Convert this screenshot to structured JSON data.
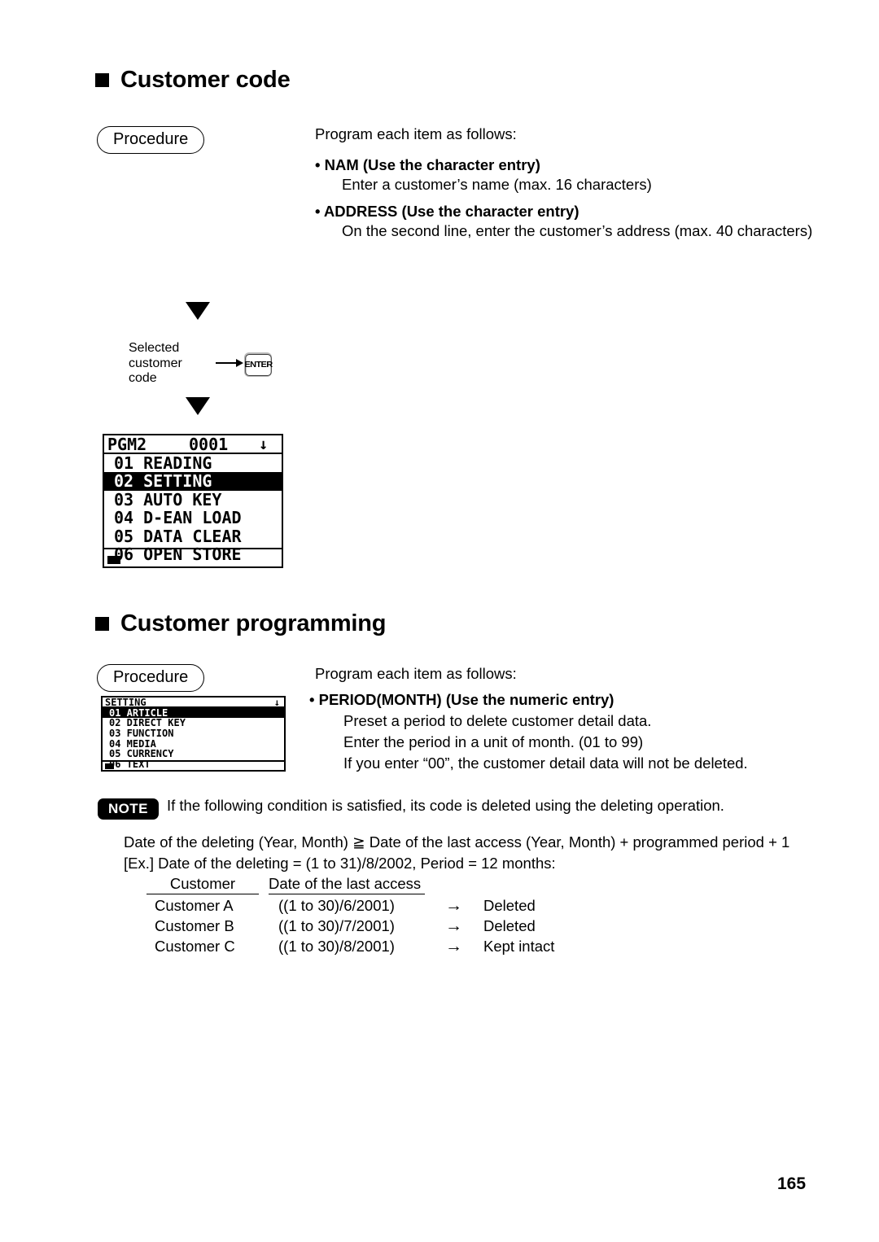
{
  "page": {
    "number": "165"
  },
  "section_customer_code": {
    "heading": "Customer code",
    "procedure_label": "Procedure",
    "intro": "Program each item as follows:",
    "items": [
      {
        "title": "• NAM (Use the character entry)",
        "description": "Enter a customer’s name (max. 16 characters)"
      },
      {
        "title": "• ADDRESS (Use the character entry)",
        "description": "On the second line, enter the customer’s address (max. 40 characters)"
      }
    ],
    "flow": {
      "input_label_line1": "Selected",
      "input_label_line2": "customer",
      "input_label_line3": "code",
      "key_label": "ENTER"
    },
    "lcd": {
      "header_title": "PGM2",
      "header_number": "0001",
      "header_scroll_icon": "↓",
      "rows": [
        {
          "text": "01 READING",
          "selected": false
        },
        {
          "text": "02 SETTING",
          "selected": true
        },
        {
          "text": "03 AUTO KEY",
          "selected": false
        },
        {
          "text": "04 D-EAN LOAD",
          "selected": false
        },
        {
          "text": "05 DATA CLEAR",
          "selected": false
        },
        {
          "text": "06 OPEN STORE",
          "selected": false
        }
      ]
    }
  },
  "section_customer_programming": {
    "heading": "Customer programming",
    "procedure_label": "Procedure",
    "intro": "Program each item as follows:",
    "items": [
      {
        "title": "• PERIOD(MONTH) (Use the numeric entry)",
        "lines": [
          "Preset a period to delete customer detail data.",
          "Enter the period in a unit of month. (01 to 99)",
          "If you enter “00”, the customer detail data will not be deleted."
        ]
      }
    ],
    "lcd": {
      "header_title": "SETTING",
      "header_scroll_icon": "↓",
      "rows": [
        {
          "text": "01 ARTICLE",
          "selected": true
        },
        {
          "text": "02 DIRECT KEY",
          "selected": false
        },
        {
          "text": "03 FUNCTION",
          "selected": false
        },
        {
          "text": "04 MEDIA",
          "selected": false
        },
        {
          "text": "05 CURRENCY",
          "selected": false
        },
        {
          "text": "06 TEXT",
          "selected": false
        }
      ]
    }
  },
  "note": {
    "badge": "NOTE",
    "text": "If the following condition is satisfied, its code is deleted using the deleting operation.",
    "condition": "Date of the deleting (Year, Month) ≧ Date of the last access (Year, Month) + programmed period + 1",
    "example": "[Ex.]  Date of the deleting = (1 to 31)/8/2002, Period = 12 months:",
    "table": {
      "headers": [
        "Customer",
        "Date of the last access"
      ],
      "rows": [
        {
          "customer": "Customer A",
          "date": "((1 to 30)/6/2001)",
          "arrow": "→",
          "result": "Deleted"
        },
        {
          "customer": "Customer B",
          "date": "((1 to 30)/7/2001)",
          "arrow": "→",
          "result": "Deleted"
        },
        {
          "customer": "Customer C",
          "date": "((1 to 30)/8/2001)",
          "arrow": "→",
          "result": "Kept intact"
        }
      ]
    }
  }
}
